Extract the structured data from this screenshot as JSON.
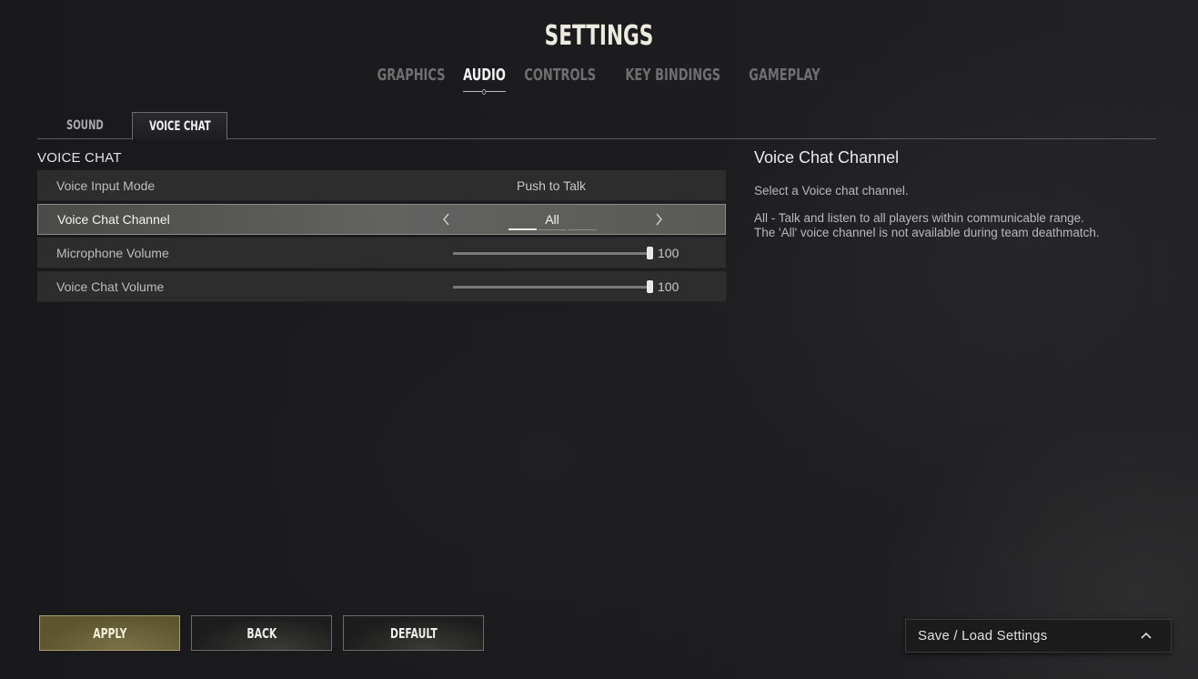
{
  "header": {
    "title": "SETTINGS",
    "tabs": [
      {
        "label": "GRAPHICS",
        "active": false
      },
      {
        "label": "AUDIO",
        "active": true
      },
      {
        "label": "CONTROLS",
        "active": false
      },
      {
        "label": "KEY BINDINGS",
        "active": false
      },
      {
        "label": "GAMEPLAY",
        "active": false
      }
    ]
  },
  "sub_tabs": [
    {
      "label": "SOUND",
      "active": false
    },
    {
      "label": "VOICE CHAT",
      "active": true
    }
  ],
  "section": {
    "label": "VOICE CHAT",
    "rows": [
      {
        "label": "Voice Input Mode",
        "value": "Push to Talk",
        "type": "text"
      },
      {
        "label": "Voice Chat Channel",
        "value": "All",
        "type": "selector",
        "option_count": 3,
        "option_index": 0,
        "left_icon": "chevron-left-icon",
        "right_icon": "chevron-right-icon"
      },
      {
        "label": "Microphone Volume",
        "value": "100",
        "type": "slider",
        "percent": 100
      },
      {
        "label": "Voice Chat Volume",
        "value": "100",
        "type": "slider",
        "percent": 100
      }
    ]
  },
  "description": {
    "title": "Voice Chat Channel",
    "line1": "Select a Voice chat channel.",
    "line2": "All - Talk and listen to all players within communicable range.",
    "line3": "The 'All' voice channel is not available during team deathmatch."
  },
  "footer": {
    "apply_label": "APPLY",
    "back_label": "BACK",
    "default_label": "DEFAULT",
    "save_load_label": "Save / Load Settings",
    "save_load_icon": "chevron-up-icon"
  },
  "colors": {
    "accent_apply": "#6b6338",
    "active_text": "#f2f2f2",
    "inactive_text": "#6f6f6f"
  }
}
